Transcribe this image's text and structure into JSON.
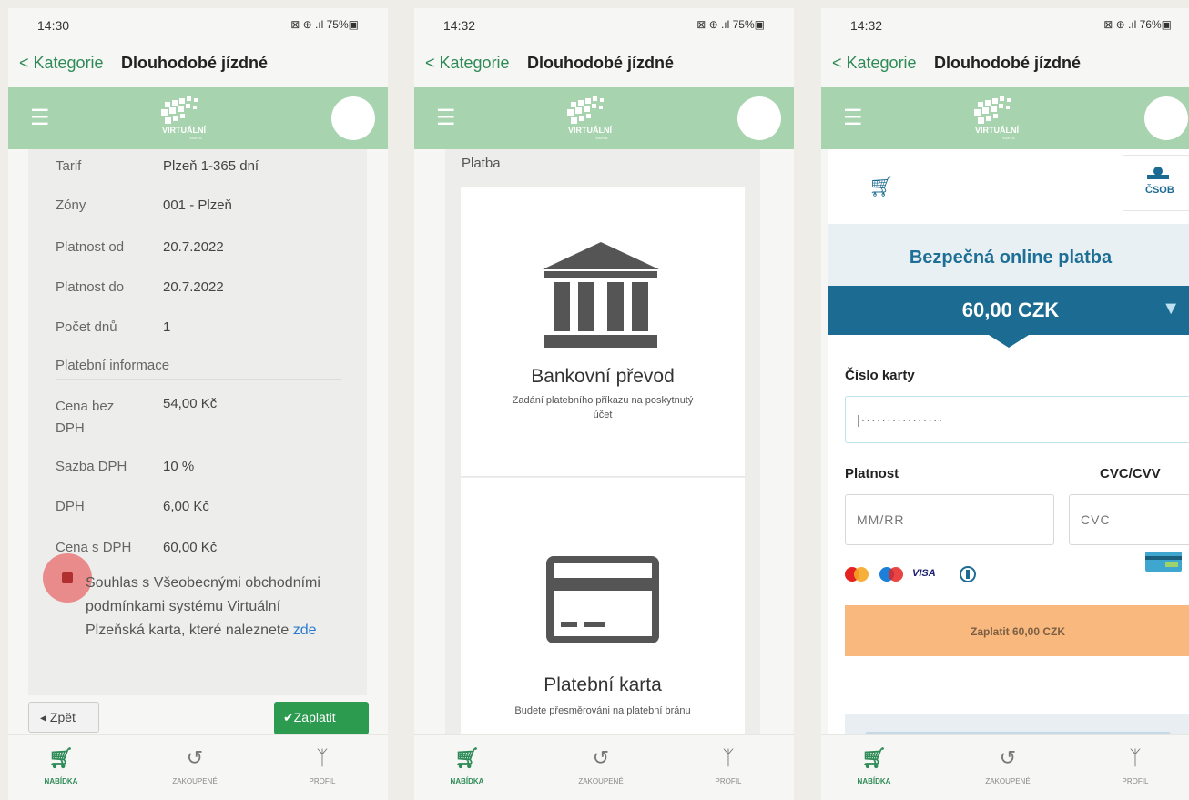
{
  "screens": [
    {
      "status": {
        "time": "14:30",
        "signal": "⊠ ⊕ .ıl 75%▣"
      },
      "titlebar": {
        "back": "< Kategorie",
        "title": "Dlouhodobé jízdné"
      },
      "details": [
        {
          "label": "Tarif",
          "value": "Plzeň 1-365 dní"
        },
        {
          "label": "Zóny",
          "value": "001 - Plzeň"
        },
        {
          "label": "Platnost od",
          "value": "20.7.2022"
        },
        {
          "label": "Platnost do",
          "value": "20.7.2022"
        },
        {
          "label": "Počet dnů",
          "value": "1"
        }
      ],
      "section_title": "Platební informace",
      "payment_rows": [
        {
          "label": "Cena bez DPH",
          "value": "54,00 Kč"
        },
        {
          "label": "Sazba DPH",
          "value": "10 %"
        },
        {
          "label": "DPH",
          "value": "6,00 Kč"
        },
        {
          "label": "Cena s DPH",
          "value": "60,00 Kč"
        }
      ],
      "agreement": {
        "text": "Souhlas s Všeobecnými obchodními podmínkami systému Virtuální Plzeňská karta, které naleznete",
        "link": "zde",
        "checked": true
      },
      "back_button": "◂ Zpět",
      "pay_button": "✔Zaplatit"
    },
    {
      "status": {
        "time": "14:32",
        "signal": "⊠ ⊕ .ıl 75%▣"
      },
      "titlebar": {
        "back": "< Kategorie",
        "title": "Dlouhodobé jízdné"
      },
      "section_title": "Platba",
      "options": [
        {
          "title": "Bankovní převod",
          "subtitle": "Zadání platebního příkazu na poskytnutý účet",
          "icon": "bank-icon"
        },
        {
          "title": "Platební karta",
          "subtitle": "Budete přesměrováni na platební bránu",
          "icon": "credit-card-icon"
        }
      ]
    },
    {
      "status": {
        "time": "14:32",
        "signal": "⊠ ⊕ .ıl 76%▣"
      },
      "titlebar": {
        "back": "< Kategorie",
        "title": "Dlouhodobé jízdné"
      },
      "gateway": {
        "bank_logo": "ČSOB",
        "heading": "Bezpečná online platba",
        "amount": "60,00 CZK",
        "card_number_label": "Číslo karty",
        "card_number_placeholder": "|················",
        "expiry_label": "Platnost",
        "expiry_placeholder": "MM/RR",
        "cvc_label": "CVC/CVV",
        "cvc_placeholder": "CVC",
        "brands": [
          "VISA"
        ],
        "pay_button": "Zaplatit 60,00 CZK"
      }
    }
  ],
  "appbar": {
    "logo_text": "VIRTUÁLNÍ",
    "logo_sub": "KARTA"
  },
  "bottom_nav": [
    {
      "label": "NABÍDKA",
      "icon": "cart-icon"
    },
    {
      "label": "ZAKOUPENÉ",
      "icon": "history-icon"
    },
    {
      "label": "PROFIL",
      "icon": "person-icon"
    }
  ],
  "colors": {
    "accent": "#2c9a4f",
    "appbar": "#a7d3ae",
    "gateway_blue": "#1c6b92",
    "pay_orange": "#f9b97e"
  }
}
